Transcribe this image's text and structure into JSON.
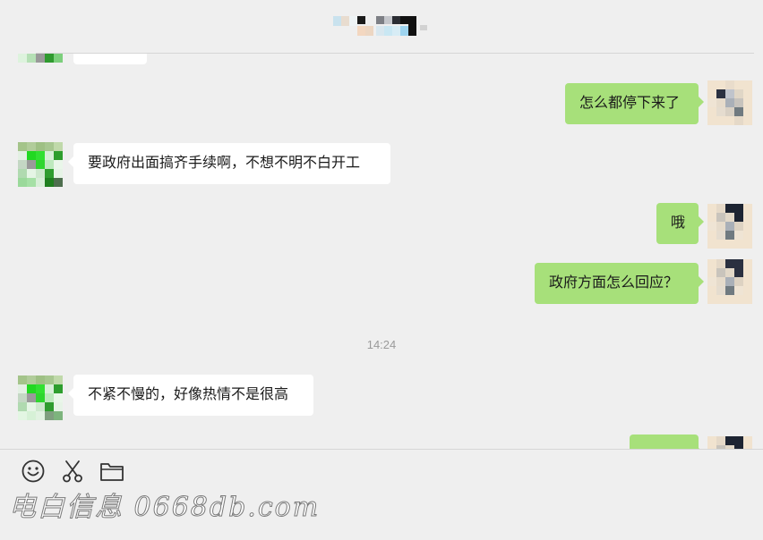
{
  "messages": [
    {
      "side": "left",
      "text": ""
    },
    {
      "side": "right",
      "text": "怎么都停下来了"
    },
    {
      "side": "left",
      "text": "要政府出面搞齐手续啊，不想不明不白开工"
    },
    {
      "side": "right",
      "text": "哦"
    },
    {
      "side": "right",
      "text": "政府方面怎么回应？"
    },
    {
      "side": "left",
      "text": "不紧不慢的，好像热情不是很高"
    },
    {
      "side": "right",
      "text": ""
    }
  ],
  "timestamp": "14:24",
  "toolbar": {
    "emoji_icon": "emoji-icon",
    "screenshot_icon": "scissors-icon",
    "file_icon": "folder-icon"
  },
  "watermark": "电白信息 0668db.com",
  "colors": {
    "background": "#efefef",
    "bubble_sent": "#a7e07a",
    "bubble_received": "#ffffff"
  }
}
